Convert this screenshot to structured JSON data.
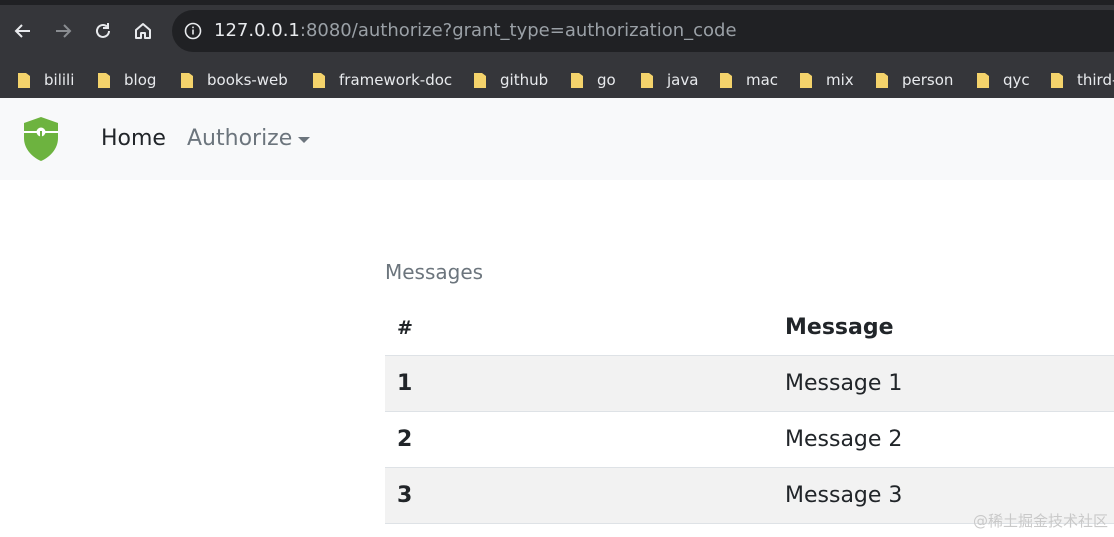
{
  "browser": {
    "url_host": "127.0.0.1",
    "url_rest": ":8080/authorize?grant_type=authorization_code",
    "bookmarks": [
      "bilili",
      "blog",
      "books-web",
      "framework-doc",
      "github",
      "go",
      "java",
      "mac",
      "mix",
      "person",
      "qyc",
      "third-"
    ]
  },
  "navbar": {
    "home_label": "Home",
    "authorize_label": "Authorize"
  },
  "main": {
    "section_title": "Messages",
    "columns": [
      "#",
      "Message"
    ],
    "rows": [
      {
        "num": "1",
        "message": "Message 1"
      },
      {
        "num": "2",
        "message": "Message 2"
      },
      {
        "num": "3",
        "message": "Message 3"
      }
    ]
  },
  "watermark": "@稀土掘金技术社区",
  "colors": {
    "chrome_bg": "#35363a",
    "omnibox_bg": "#202124",
    "navbar_bg": "#f8f9fa",
    "logo_green": "#6db33f",
    "folder_yellow": "#f4d36b"
  }
}
